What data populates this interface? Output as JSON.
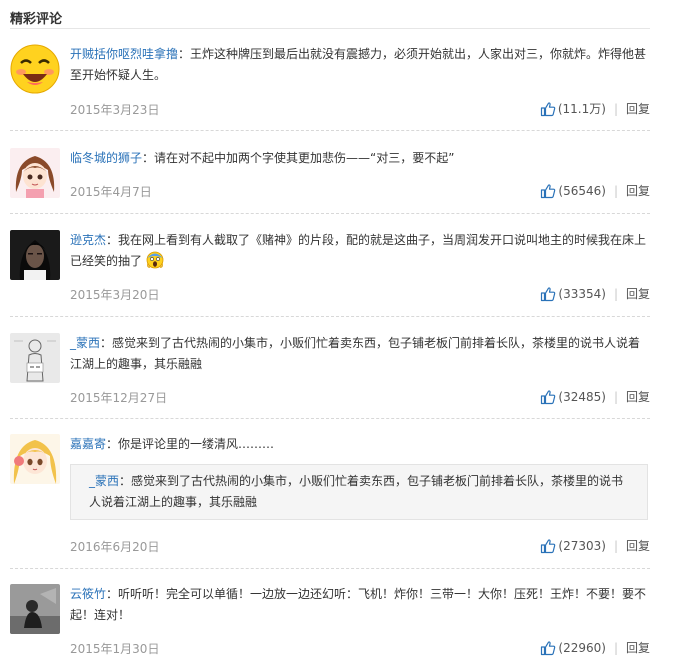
{
  "section_title": "精彩评论",
  "colors": {
    "user": "#2a72b8",
    "meta": "#999999",
    "like_icon": "#2a72b8"
  },
  "comments": [
    {
      "user": "开贼括你呕烈哇拿撸",
      "text": "：王炸这种牌压到最后出就没有震撼力，必须开始就出，人家出对三，你就炸。炸得他甚至开始怀疑人生。",
      "date": "2015年3月23日",
      "likes": "(11.1万)",
      "reply": "回复",
      "avatar": "smiley-face"
    },
    {
      "user": "临冬城的狮子",
      "text": "：请在对不起中加两个字使其更加悲伤——“对三，要不起”",
      "date": "2015年4月7日",
      "likes": "(56546)",
      "reply": "回复",
      "avatar": "anime-girl-brown-hair"
    },
    {
      "user": "逊克杰",
      "text": "：我在网上看到有人截取了《赌神》的片段，配的就是这曲子，当周润发开口说叫地主的时候我在床上已经笑的抽了",
      "emoji": "screaming-face-emoji",
      "date": "2015年3月20日",
      "likes": "(33354)",
      "reply": "回复",
      "avatar": "dark-portrait"
    },
    {
      "user": "_蒙西",
      "text": "：感觉来到了古代热闹的小集市，小贩们忙着卖东西，包子铺老板门前排着长队，茶楼里的说书人说着江湖上的趣事，其乐融融",
      "date": "2015年12月27日",
      "likes": "(32485)",
      "reply": "回复",
      "avatar": "sketch-figure"
    },
    {
      "user": "嘉嘉寄",
      "text": "：你是评论里的一缕清风………",
      "quote": {
        "user": "_蒙西",
        "text": "：感觉来到了古代热闹的小集市，小贩们忙着卖东西，包子铺老板门前排着长队，茶楼里的说书人说着江湖上的趣事，其乐融融"
      },
      "date": "2016年6月20日",
      "likes": "(27303)",
      "reply": "回复",
      "avatar": "anime-girl-blonde"
    },
    {
      "user": "云筱竹",
      "text": "：听听听！完全可以单循！一边放一边还幻听：飞机！炸你！三带一！大你！压死！王炸！不要！要不起！连对！",
      "date": "2015年1月30日",
      "likes": "(22960)",
      "reply": "回复",
      "avatar": "gray-photo"
    }
  ]
}
